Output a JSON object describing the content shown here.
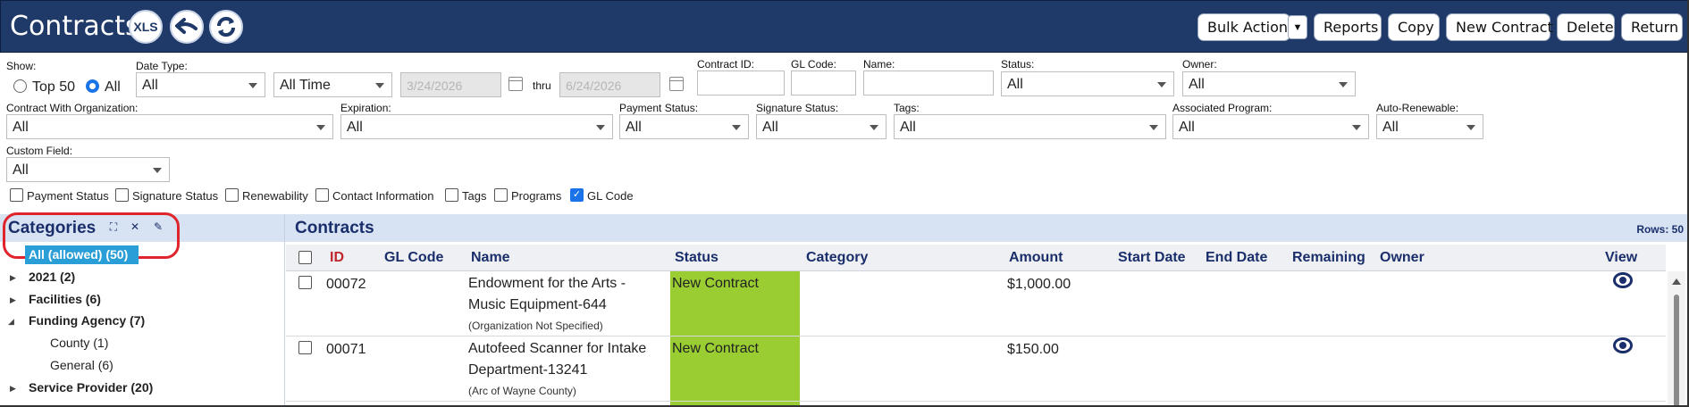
{
  "header": {
    "title": "Contracts",
    "xls_label": "XLS",
    "buttons": {
      "bulk_action": "Bulk Action",
      "reports": "Reports",
      "copy": "Copy",
      "new_contract": "New Contract",
      "delete": "Delete",
      "return": "Return"
    }
  },
  "filters": {
    "show_label": "Show:",
    "show_top50": "Top 50",
    "show_all": "All",
    "date_type_label": "Date Type:",
    "date_type_value": "All",
    "time_range_value": "All Time",
    "from_date": "3/24/2026",
    "thru_label": "thru",
    "to_date": "6/24/2026",
    "contract_id_label": "Contract ID:",
    "gl_code_label": "GL Code:",
    "name_label": "Name:",
    "status_label": "Status:",
    "status_value": "All",
    "owner_label": "Owner:",
    "owner_value": "All",
    "contract_with_org_label": "Contract With Organization:",
    "contract_with_org_value": "All",
    "expiration_label": "Expiration:",
    "expiration_value": "All",
    "payment_status_label": "Payment Status:",
    "payment_status_value": "All",
    "signature_status_label": "Signature Status:",
    "signature_status_value": "All",
    "tags_label": "Tags:",
    "tags_value": "All",
    "associated_program_label": "Associated Program:",
    "associated_program_value": "All",
    "auto_renewable_label": "Auto-Renewable:",
    "auto_renewable_value": "All",
    "custom_field_label": "Custom Field:",
    "custom_field_value": "All",
    "columns": {
      "payment_status": "Payment Status",
      "signature_status": "Signature Status",
      "renewability": "Renewability",
      "contact_information": "Contact Information",
      "tags": "Tags",
      "programs": "Programs",
      "gl_code": "GL Code"
    }
  },
  "categories": {
    "title": "Categories",
    "items": {
      "all": "All (allowed) (50)",
      "y2021": "2021 (2)",
      "facilities": "Facilities (6)",
      "funding_agency": "Funding Agency (7)",
      "county": "County (1)",
      "general": "General (6)",
      "service_provider": "Service Provider (20)"
    }
  },
  "grid": {
    "title": "Contracts",
    "rows_label": "Rows: 50",
    "columns": {
      "id": "ID",
      "gl_code": "GL Code",
      "name": "Name",
      "status": "Status",
      "category": "Category",
      "amount": "Amount",
      "start_date": "Start Date",
      "end_date": "End Date",
      "remaining": "Remaining",
      "owner": "Owner",
      "view": "View"
    },
    "rows": [
      {
        "id": "00072",
        "name_line1": "Endowment for the Arts -",
        "name_line2": "Music Equipment-644",
        "org": "(Organization Not Specified)",
        "status": "New Contract",
        "amount": "$1,000.00"
      },
      {
        "id": "00071",
        "name_line1": "Autofeed Scanner for Intake",
        "name_line2": "Department-13241",
        "org": "(Arc of Wayne County)",
        "status": "New Contract",
        "amount": "$150.00"
      }
    ]
  },
  "colors": {
    "header_bg": "#1f3a68",
    "status_new_contract": "#9acd32",
    "selected_category": "#2a9ed6",
    "highlight_ring": "#e0242c"
  }
}
